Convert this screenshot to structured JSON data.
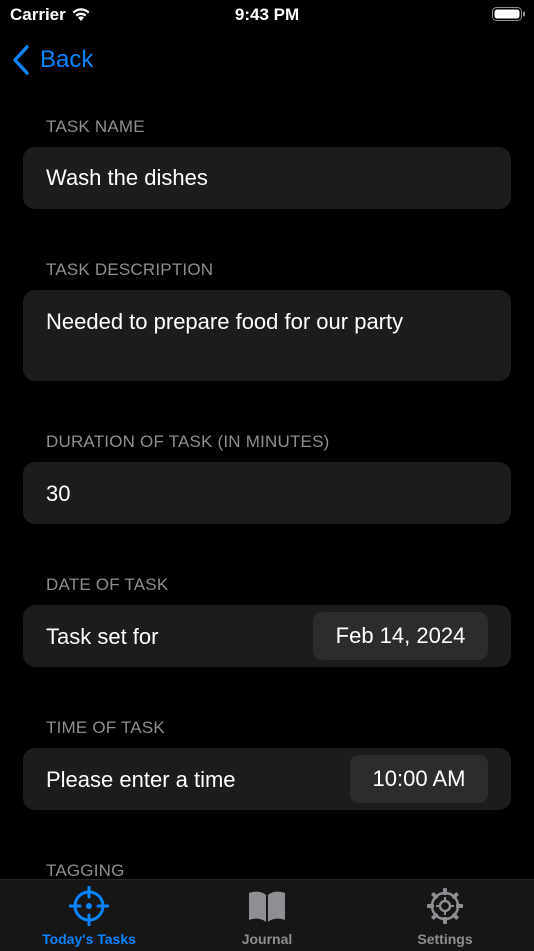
{
  "status_bar": {
    "carrier": "Carrier",
    "time": "9:43 PM"
  },
  "nav": {
    "back_label": "Back"
  },
  "sections": {
    "task_name": {
      "header": "TASK NAME",
      "value": "Wash the dishes"
    },
    "task_description": {
      "header": "TASK DESCRIPTION",
      "value": "Needed to prepare food for our party"
    },
    "duration": {
      "header": "DURATION OF TASK (IN MINUTES)",
      "value": "30"
    },
    "date": {
      "header": "DATE OF TASK",
      "label": "Task set for",
      "value": "Feb 14, 2024"
    },
    "time": {
      "header": "TIME OF TASK",
      "label": "Please enter a time",
      "value": "10:00 AM"
    },
    "tagging": {
      "header": "TAGGING"
    }
  },
  "tab_bar": {
    "tabs": [
      {
        "label": "Today's Tasks",
        "icon": "crosshair-icon",
        "active": true
      },
      {
        "label": "Journal",
        "icon": "book-icon",
        "active": false
      },
      {
        "label": "Settings",
        "icon": "gear-icon",
        "active": false
      }
    ]
  },
  "colors": {
    "accent": "#0a84ff",
    "card": "#1c1c1e",
    "pill": "#2c2c2e",
    "secondary_text": "#8e8e93"
  }
}
